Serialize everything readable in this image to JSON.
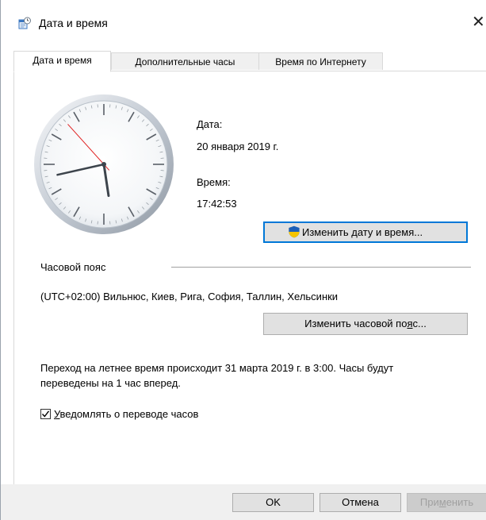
{
  "window": {
    "title": "Дата и время",
    "close_glyph": "✕",
    "icon": "date-time-control-panel-icon"
  },
  "tabs": [
    {
      "label": "Дата и время",
      "active": true
    },
    {
      "label": "Дополнительные часы",
      "active": false
    },
    {
      "label": "Время по Интернету",
      "active": false
    }
  ],
  "clock": {
    "hours": 17,
    "minutes": 42,
    "seconds": 53
  },
  "date": {
    "label": "Дата:",
    "value": "20 января 2019 г."
  },
  "time": {
    "label": "Время:",
    "value": "17:42:53"
  },
  "change_datetime_button": {
    "label_pre": "Изменить ",
    "label_u": "д",
    "label_post": "ату и время...",
    "icon": "uac-shield-icon"
  },
  "timezone": {
    "section_label": "Часовой пояс",
    "value": "(UTC+02:00) Вильнюс, Киев, Рига, София, Таллин, Хельсинки",
    "change_label_pre": "Изменить часовой по",
    "change_label_u": "я",
    "change_label_post": "с..."
  },
  "dst": {
    "line1": "Переход на летнее время происходит 31 марта 2019 г. в 3:00. Часы будут",
    "line2": "переведены на 1 час вперед."
  },
  "notify": {
    "checked": true,
    "label_u": "У",
    "label_rest": "ведомлять о переводе часов"
  },
  "footer": {
    "ok": "OK",
    "cancel": "Отмена",
    "apply_pre": "При",
    "apply_u": "м",
    "apply_post": "енить"
  },
  "colors": {
    "accent": "#0078d7",
    "uac_blue": "#1c5fb8",
    "uac_yellow": "#f5c400"
  }
}
